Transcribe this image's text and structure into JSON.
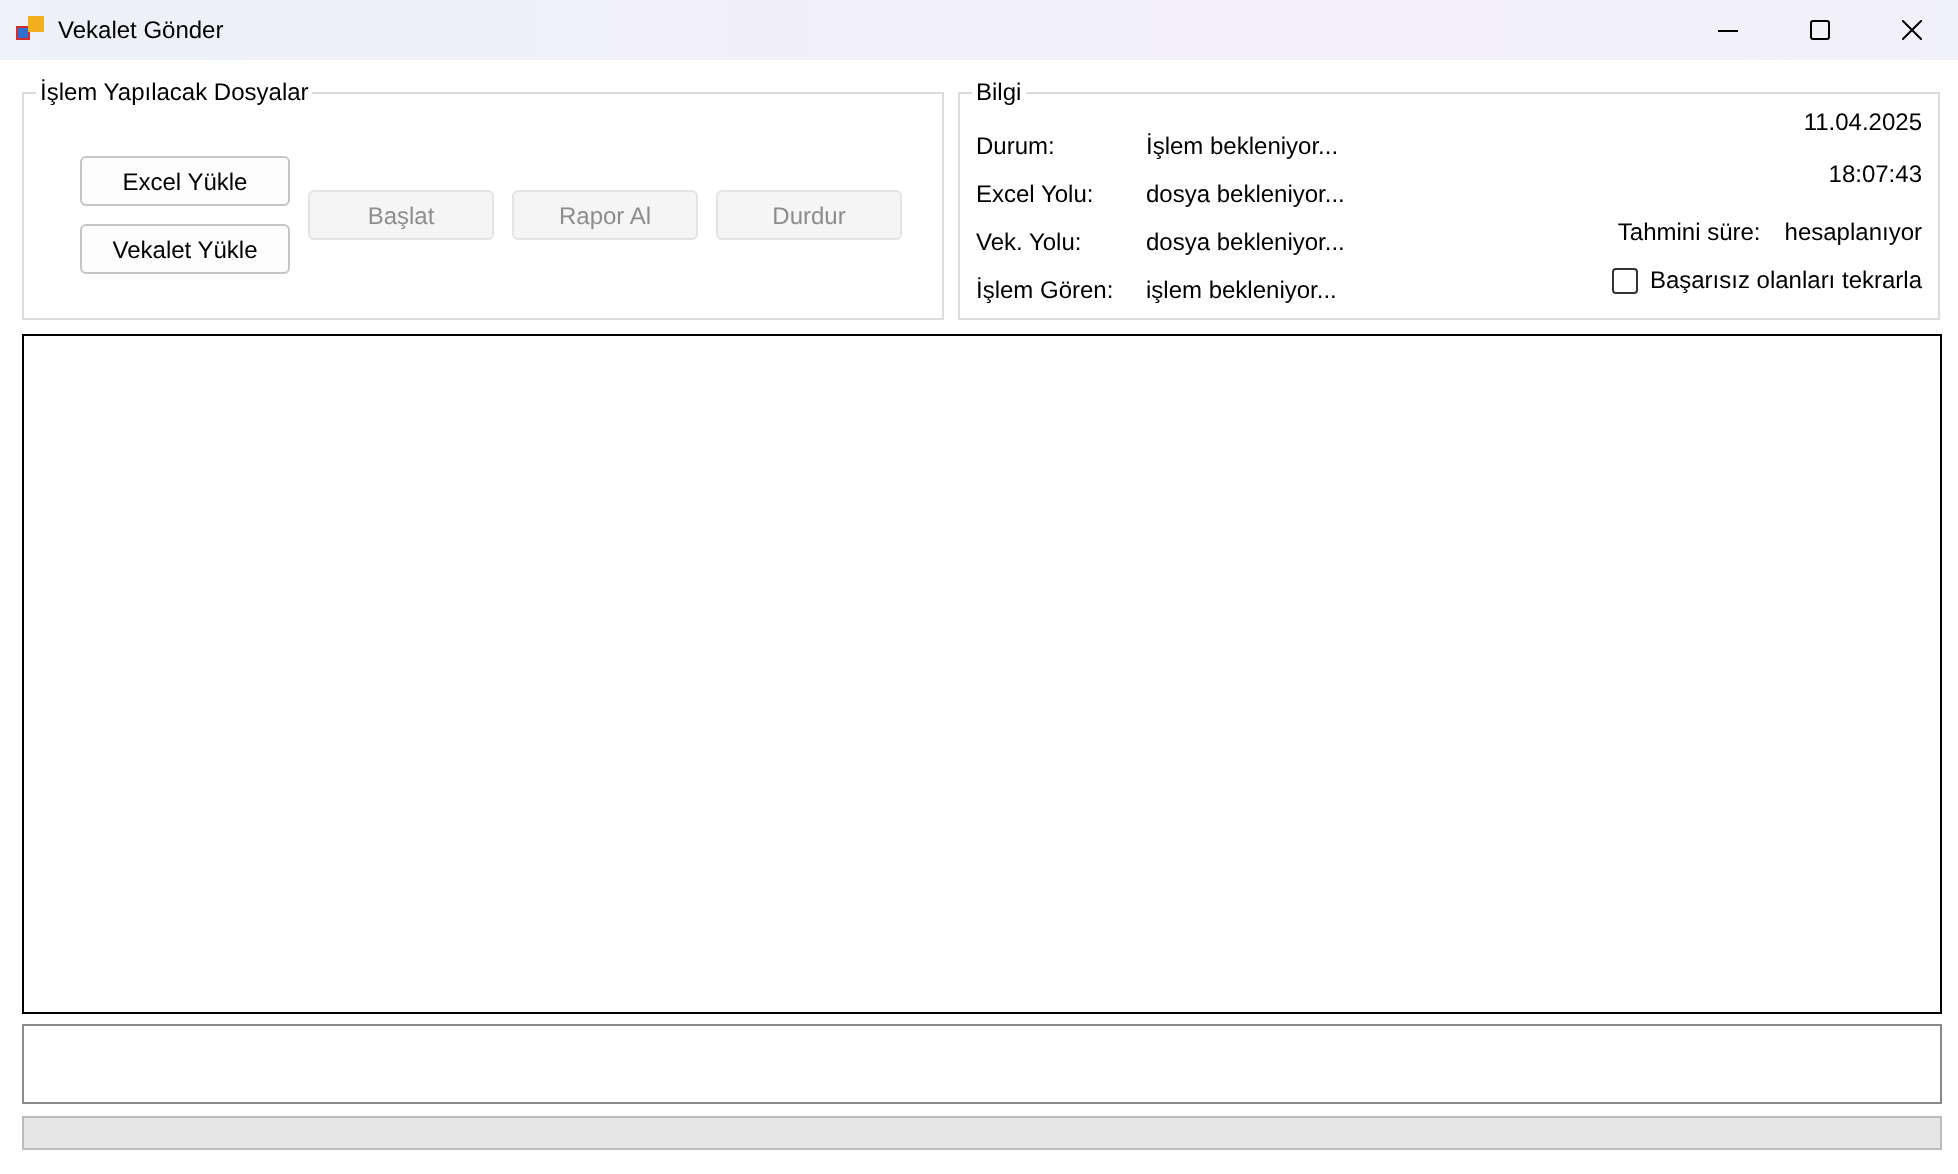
{
  "window": {
    "title": "Vekalet Gönder"
  },
  "files_group": {
    "title": "İşlem Yapılacak Dosyalar",
    "load_buttons": [
      {
        "label": "Excel Yükle",
        "disabled": false
      },
      {
        "label": "Vekalet Yükle",
        "disabled": false
      }
    ],
    "action_buttons": [
      {
        "label": "Başlat",
        "disabled": true
      },
      {
        "label": "Rapor Al",
        "disabled": true
      },
      {
        "label": "Durdur",
        "disabled": true
      }
    ]
  },
  "info_group": {
    "title": "Bilgi",
    "rows": [
      {
        "label": "Durum:",
        "value": "İşlem bekleniyor..."
      },
      {
        "label": "Excel Yolu:",
        "value": "dosya bekleniyor..."
      },
      {
        "label": "Vek. Yolu:",
        "value": "dosya bekleniyor..."
      },
      {
        "label": "İşlem Gören:",
        "value": "işlem bekleniyor..."
      }
    ],
    "date": "11.04.2025",
    "time": "18:07:43",
    "estimate": {
      "label": "Tahmini süre:",
      "value": "hesaplanıyor"
    },
    "retry_failed": {
      "label": "Başarısız olanları tekrarla",
      "checked": false
    }
  },
  "progress": {
    "level": 0
  }
}
